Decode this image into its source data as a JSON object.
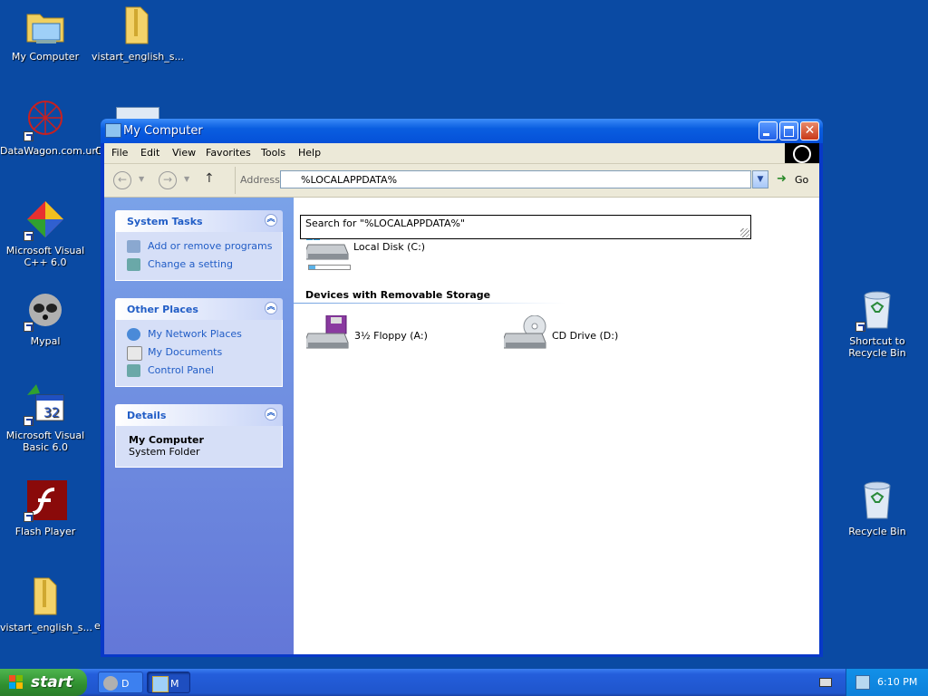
{
  "desktop": {
    "icons": [
      {
        "label": "My Computer"
      },
      {
        "label": "vistart_english_s..."
      },
      {
        "label": "DataWagon.com.url"
      },
      {
        "label": "Microsoft Visual C++ 6.0"
      },
      {
        "label": "Mypal"
      },
      {
        "label": "Microsoft Visual Basic 6.0"
      },
      {
        "label": "Flash Player"
      },
      {
        "label": "vistart_english_s..."
      },
      {
        "label": "Shortcut to Recycle Bin"
      },
      {
        "label": "Recycle Bin"
      }
    ],
    "partial_labels": [
      "C",
      "e"
    ]
  },
  "window": {
    "title": "My Computer",
    "close_glyph": "✕",
    "menu": [
      "File",
      "Edit",
      "View",
      "Favorites",
      "Tools",
      "Help"
    ],
    "toolbar": {
      "back_glyph": "←",
      "forward_glyph": "→",
      "up_glyph": "↑",
      "caret_glyph": "▼",
      "address_label": "Address",
      "address_value": "%LOCALAPPDATA%",
      "go_glyph": "➜",
      "go_label": "Go"
    },
    "autocomplete": "Search for \"%LOCALAPPDATA%\"",
    "panels": {
      "system_tasks": {
        "title": "System Tasks",
        "chevron": "︽",
        "links": [
          "Add or remove programs",
          "Change a setting"
        ]
      },
      "other_places": {
        "title": "Other Places",
        "chevron": "︽",
        "links": [
          "My Network Places",
          "My Documents",
          "Control Panel"
        ]
      },
      "details": {
        "title": "Details",
        "chevron": "︽",
        "name": "My Computer",
        "type": "System Folder"
      }
    },
    "content": {
      "local_disk": {
        "label": "Local Disk (C:)",
        "used_fraction": 0.15
      },
      "section_title": "Devices with Removable Storage",
      "floppy": {
        "label": "3½ Floppy (A:)"
      },
      "cd": {
        "label": "CD Drive (D:)"
      }
    }
  },
  "taskbar": {
    "start_label": "start",
    "tasks": [
      {
        "label": "D"
      },
      {
        "label": "M"
      }
    ],
    "clock": "6:10 PM"
  },
  "colors": {
    "desktop": "#0a4aa3",
    "link": "#215dc6",
    "titlebar": "#0a5ee0",
    "start": "#2f8f2f"
  }
}
